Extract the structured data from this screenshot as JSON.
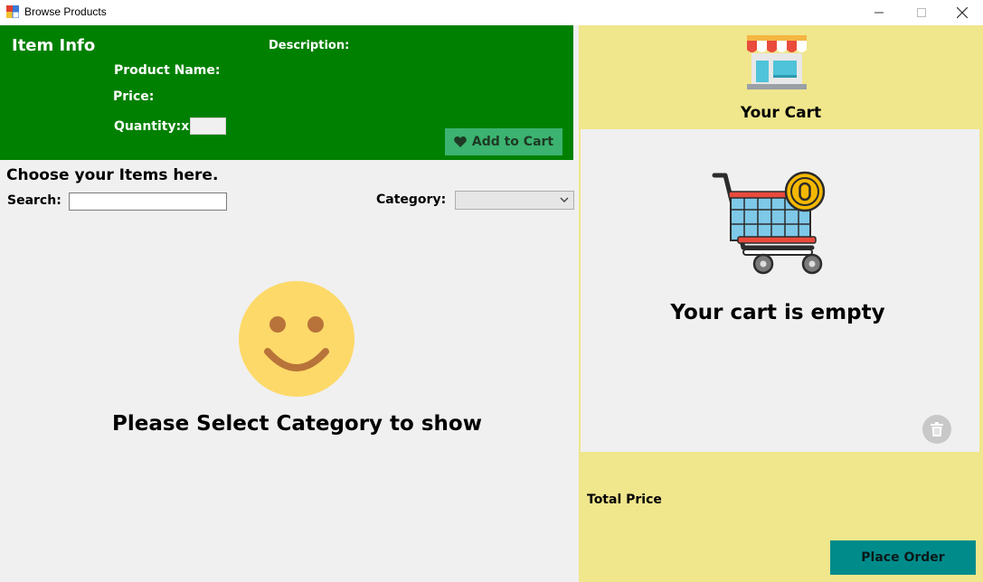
{
  "window": {
    "title": "Browse Products",
    "icons": {
      "app": "app-icon",
      "minimize": "minimize-icon",
      "maximize": "maximize-icon",
      "close": "close-icon"
    }
  },
  "item_info": {
    "title": "Item Info",
    "description_label": "Description:",
    "product_name_label": "Product Name:",
    "price_label": "Price:",
    "quantity_label": "Quantity:x",
    "quantity_value": "",
    "add_to_cart_label": "Add to Cart",
    "add_to_cart_icon": "heart-icon",
    "panel_color": "#008000",
    "button_color": "#3cb371"
  },
  "browse": {
    "heading": "Choose your Items here.",
    "search_label": "Search:",
    "search_value": "",
    "category_label": "Category:",
    "category_value": "",
    "placeholder_icon": "smiley-icon",
    "placeholder_message": "Please Select Category to show"
  },
  "cart": {
    "store_icon": "store-icon",
    "title": "Your Cart",
    "cart_icon": "shopping-cart-icon",
    "empty_message": "Your cart is empty",
    "trash_icon": "trash-icon",
    "total_label": "Total Price",
    "total_value": "",
    "place_order_label": "Place Order",
    "panel_color": "#f0e68c",
    "button_color": "#008b8b"
  }
}
